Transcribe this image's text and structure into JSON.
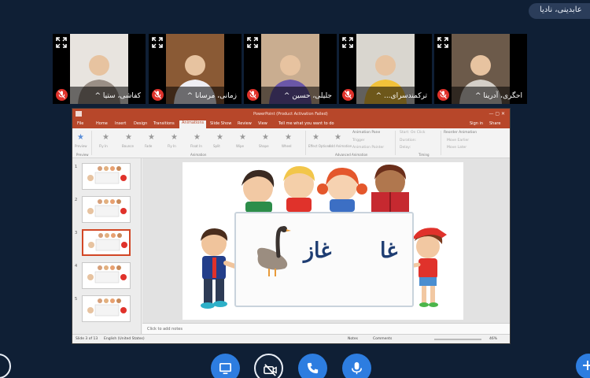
{
  "header": {
    "user_badge": "عابدینی، نادیا"
  },
  "participants": [
    {
      "name": "کفاشی، ستیا",
      "bg": "#e8e4df",
      "accent": "#9a8f86",
      "muted": true
    },
    {
      "name": "زمانی، مرسانا",
      "bg": "#8a5a35",
      "accent": "#efeef3",
      "muted": true
    },
    {
      "name": "جلیلی، حسین",
      "bg": "#c9ad90",
      "accent": "#6b57a8",
      "muted": true
    },
    {
      "name": "ترکمندسرای...",
      "bg": "#d9d6cf",
      "accent": "#f2c23a",
      "muted": true
    },
    {
      "name": "احگری، آدرینا",
      "bg": "#6c5a4a",
      "accent": "#d4cfc8",
      "muted": true
    }
  ],
  "powerpoint": {
    "title": "PowerPoint (Product Activation Failed)",
    "tabs": [
      "File",
      "Home",
      "Insert",
      "Design",
      "Transitions",
      "Animations",
      "Slide Show",
      "Review",
      "View"
    ],
    "active_tab": "Animations",
    "tell_me": "Tell me what you want to do",
    "sign_in": "Sign in",
    "share": "Share",
    "preview_label": "Preview",
    "effects": [
      "Fly In",
      "Bounce",
      "Fade",
      "Fly In",
      "Float In",
      "Split",
      "Wipe",
      "Shape",
      "Wheel"
    ],
    "effect_options": "Effect Options",
    "add_animation": "Add Animation",
    "animation_pane": "Animation Pane",
    "trigger": "Trigger",
    "animation_painter": "Animation Painter",
    "start": "Start: On Click",
    "duration": "Duration:",
    "delay": "Delay:",
    "reorder": "Reorder Animation",
    "move_earlier": "Move Earlier",
    "move_later": "Move Later",
    "sections": {
      "preview": "Preview",
      "animation": "Animation",
      "advanced": "Advanced Animation",
      "timing": "Timing"
    },
    "slide_numbers": [
      "1",
      "2",
      "3",
      "4",
      "5"
    ],
    "selected_slide": "3",
    "slide_words": {
      "right": "غا",
      "left": "غاز"
    },
    "notes_placeholder": "Click to add notes",
    "status": {
      "slide": "Slide 3 of 13",
      "language": "English (United States)",
      "notes": "Notes",
      "comments": "Comments",
      "zoom": "46%"
    }
  },
  "controls": [
    "video",
    "screen-share-off",
    "end-call",
    "microphone"
  ],
  "colors": {
    "bg": "#0f1f35",
    "accent": "#2d7de0",
    "ppt": "#b7472a",
    "word": "#1e3d72"
  }
}
